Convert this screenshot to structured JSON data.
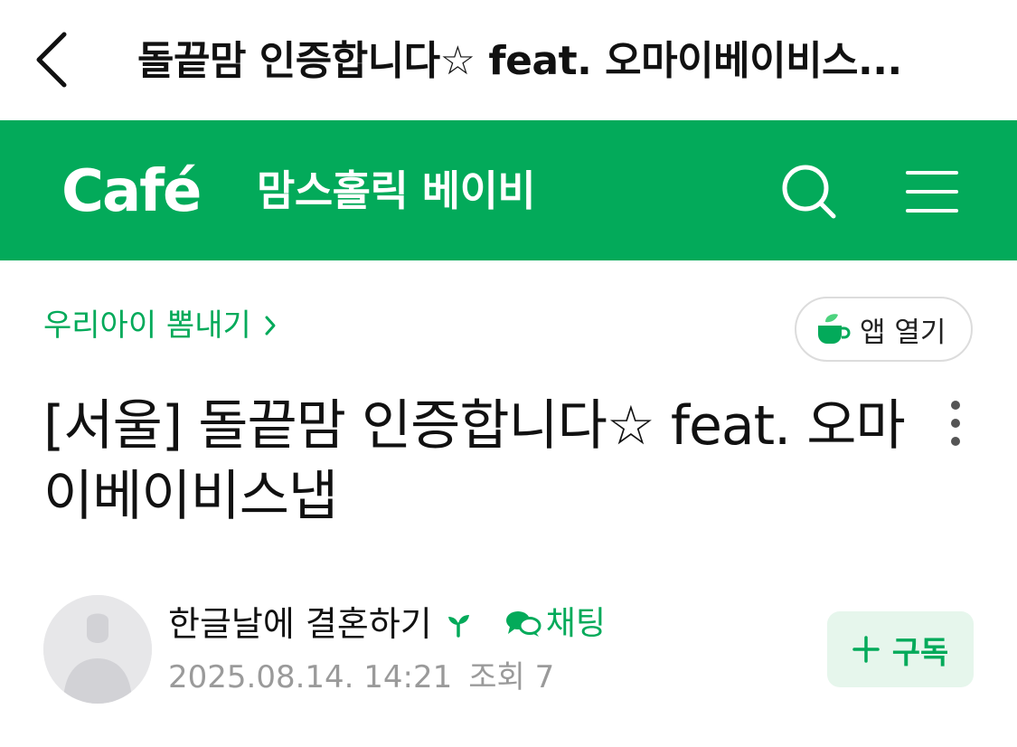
{
  "top_bar": {
    "title": "돌끝맘 인증합니다☆ feat. 오마이베이비스..."
  },
  "header": {
    "logo": "Café",
    "cafe_name": "맘스홀릭 베이비",
    "icons": [
      "search-icon",
      "menu-icon"
    ],
    "background_color": "#03aa5a"
  },
  "board": {
    "breadcrumb": "우리아이 뽐내기",
    "app_open_label": "앱 열기"
  },
  "post": {
    "title": "[서울] 돌끝맘 인증합니다☆ feat. 오마이베이비스냅",
    "author": "한글날에 결혼하기",
    "chat_label": "채팅",
    "date": "2025.08.14. 14:21",
    "views": "조회 7",
    "subscribe_label": "구독"
  },
  "colors": {
    "accent": "#03aa5a",
    "muted_text": "#9a9a9a",
    "subscribe_bg": "#e6f6ec"
  }
}
